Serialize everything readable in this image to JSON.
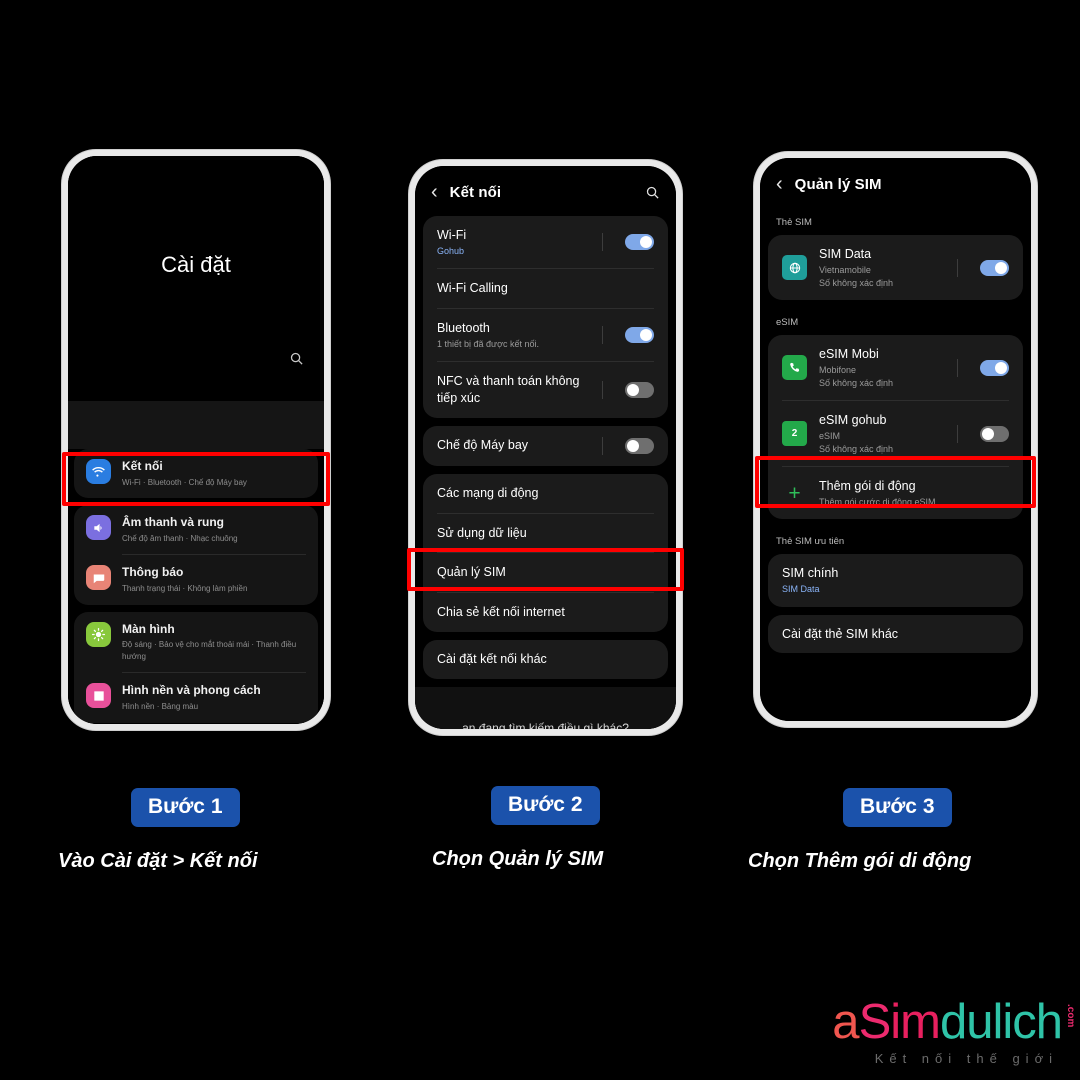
{
  "phone1": {
    "hero_title": "Cài đặt",
    "search_icon": "search-icon",
    "items": [
      {
        "title": "Kết nối",
        "subtitle": "Wi-Fi  ·  Bluetooth  ·  Chế độ Máy bay",
        "icon": "wifi-icon",
        "color": "#2a7de1",
        "highlighted": true
      },
      {
        "title": "Âm thanh và rung",
        "subtitle": "Chế độ âm thanh  ·  Nhạc chuông",
        "icon": "speaker-icon",
        "color": "#7b6fe0"
      },
      {
        "title": "Thông báo",
        "subtitle": "Thanh trạng thái  ·  Không làm phiền",
        "icon": "notification-icon",
        "color": "#e88476"
      },
      {
        "title": "Màn hình",
        "subtitle": "Độ sáng  ·  Bảo vệ cho mắt thoải mái  ·  Thanh điều hướng",
        "icon": "brightness-icon",
        "color": "#88c83c"
      },
      {
        "title": "Hình nền và phong cách",
        "subtitle": "Hình nền  ·  Bảng màu",
        "icon": "wallpaper-icon",
        "color": "#e8509a"
      }
    ]
  },
  "phone2": {
    "appbar": {
      "title": "Kết nối",
      "back_icon": "chevron-left-icon",
      "search_icon": "search-icon"
    },
    "group1": [
      {
        "title": "Wi-Fi",
        "subtitle": "Gohub",
        "toggle": "on"
      },
      {
        "title": "Wi-Fi Calling",
        "subtitle": "",
        "toggle": null
      },
      {
        "title": "Bluetooth",
        "subtitle": "1 thiết bị đã được kết nối.",
        "toggle": "on"
      },
      {
        "title": "NFC và thanh toán không tiếp xúc",
        "subtitle": "",
        "toggle": "off"
      }
    ],
    "group2": [
      {
        "title": "Chế độ Máy bay",
        "subtitle": "",
        "toggle": "off"
      }
    ],
    "group3": [
      {
        "title": "Các mạng di động",
        "subtitle": "",
        "toggle": null
      },
      {
        "title": "Sử dụng dữ liệu",
        "subtitle": "",
        "toggle": null
      },
      {
        "title": "Quản lý SIM",
        "subtitle": "",
        "toggle": null,
        "highlighted": true
      },
      {
        "title": "Chia sẻ kết nối internet",
        "subtitle": "",
        "toggle": null
      }
    ],
    "group4": [
      {
        "title": "Cài đặt kết nối khác",
        "subtitle": "",
        "toggle": null
      }
    ],
    "footer_hint": "ạn đang tìm kiếm điều gì khác?"
  },
  "phone3": {
    "appbar": {
      "title": "Quản lý SIM",
      "back_icon": "chevron-left-icon"
    },
    "section_sim_label": "Thẻ SIM",
    "sim_cards": [
      {
        "title": "SIM Data",
        "line2": "Vietnamobile",
        "line3": "Số không xác định",
        "icon": "globe-sim-icon",
        "color": "#1f9e9a",
        "toggle": "on"
      }
    ],
    "section_esim_label": "eSIM",
    "esim_cards": [
      {
        "title": "eSIM Mobi",
        "line2": "Mobifone",
        "line3": "Số không xác định",
        "icon": "phone-sim-icon",
        "color": "#23a94a",
        "toggle": "on"
      },
      {
        "title": "eSIM gohub",
        "line2": "eSIM",
        "line3": "Số không xác định",
        "icon": "sim2-icon",
        "color": "#23a94a",
        "toggle": "off"
      }
    ],
    "add_plan": {
      "title": "Thêm gói di động",
      "subtitle": "Thêm gói cước di động eSIM.",
      "icon": "plus-icon",
      "color": "#2fbf5a",
      "highlighted": true
    },
    "section_priority_label": "Thẻ SIM ưu tiên",
    "priority": {
      "title": "SIM chính",
      "subtitle": "SIM Data"
    },
    "other": {
      "title": "Cài đặt thẻ SIM khác"
    }
  },
  "steps": [
    {
      "badge": "Bước 1",
      "caption_prefix": "Vào ",
      "caption_em": "Cài đặt > Kết nối"
    },
    {
      "badge": "Bước 2",
      "caption_prefix": "Chọn ",
      "caption_em": "Quản lý SIM"
    },
    {
      "badge": "Bước 3",
      "caption_prefix": "Chọn ",
      "caption_em": "Thêm gói di động"
    }
  ],
  "logo": {
    "part_a": "a",
    "part_s": "S",
    "part_im": "im",
    "part_du": "dulich",
    "dotcom": ".com",
    "tagline": "Kết nối thế giới"
  },
  "colors": {
    "badge_blue": "#1b52ab",
    "highlight_red": "#ff0000",
    "toggle_on": "#7fa8e8",
    "toggle_off": "#6f6f6f",
    "logo_pink": "#ec2a6e",
    "logo_teal": "#2fc4a8"
  }
}
